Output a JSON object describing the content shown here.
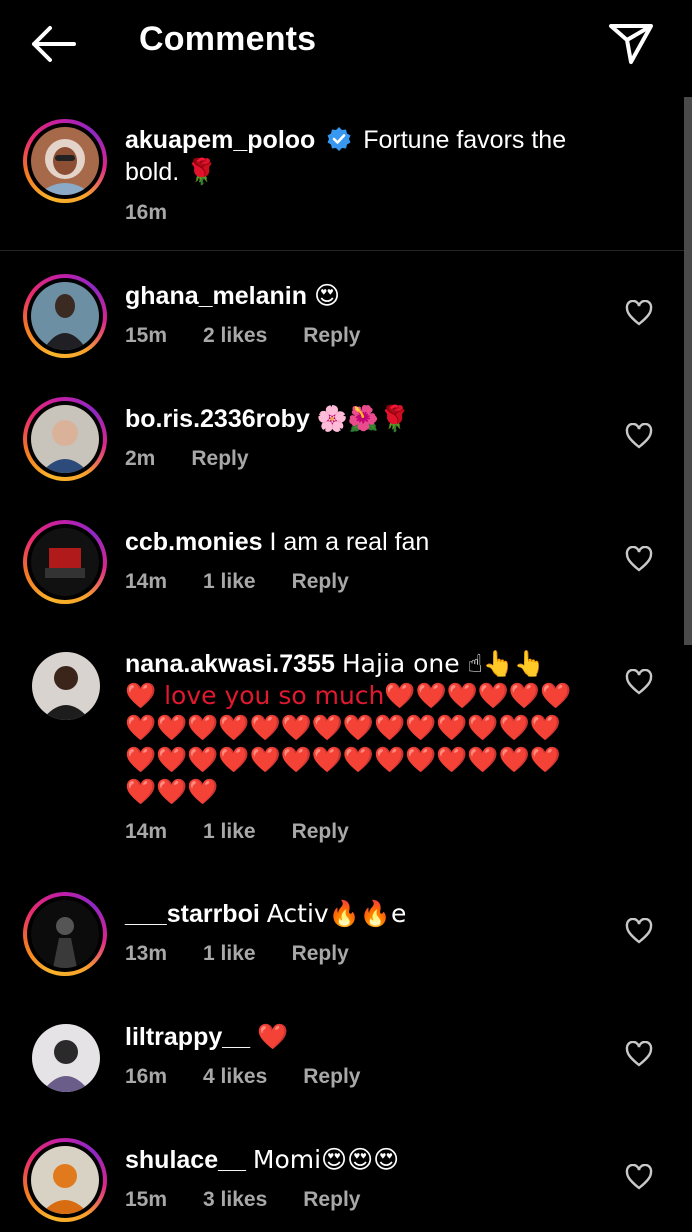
{
  "header": {
    "title": "Comments",
    "back_icon": "arrow-left-icon",
    "share_icon": "paper-plane-icon"
  },
  "caption": {
    "username": "akuapem_poloo",
    "verified": true,
    "text": "Fortune favors the bold.",
    "emoji": "🌹",
    "time": "16m"
  },
  "comments": [
    {
      "username": "ghana_melanin",
      "text": "",
      "emoji": "😍",
      "time": "15m",
      "likes": "2 likes",
      "reply": "Reply",
      "story_ring": true
    },
    {
      "username": "bo.ris.2336roby",
      "text": "",
      "emoji": "🌸🌺🌹",
      "time": "2m",
      "likes": "",
      "reply": "Reply",
      "story_ring": true
    },
    {
      "username": "ccb.monies",
      "text": "I am a real fan",
      "emoji": "",
      "time": "14m",
      "likes": "1 like",
      "reply": "Reply",
      "story_ring": true
    },
    {
      "username": "nana.akwasi.7355",
      "text": "Hajia one ☝👆👆",
      "line2": "❤️ love you so much❤️❤️❤️❤️❤️❤️",
      "line3": "❤️❤️❤️❤️❤️❤️❤️❤️❤️❤️❤️❤️❤️❤️",
      "line4": "❤️❤️❤️❤️❤️❤️❤️❤️❤️❤️❤️❤️❤️❤️",
      "line5": "❤️❤️❤️",
      "time": "14m",
      "likes": "1 like",
      "reply": "Reply",
      "story_ring": false
    },
    {
      "username": "___starrboi",
      "text": "Activ🔥🔥e",
      "emoji": "",
      "time": "13m",
      "likes": "1 like",
      "reply": "Reply",
      "story_ring": true
    },
    {
      "username": "liltrappy__",
      "text": "",
      "emoji": "❤️",
      "time": "16m",
      "likes": "4 likes",
      "reply": "Reply",
      "story_ring": false
    },
    {
      "username": "shulace__",
      "text": "Momi😍😍😍",
      "emoji": "",
      "time": "15m",
      "likes": "3 likes",
      "reply": "Reply",
      "story_ring": true
    }
  ],
  "colors": {
    "background": "#000000",
    "meta_text": "#a8a8a8",
    "verified_badge": "#3897f0",
    "heart_emoji": "#e0192f"
  }
}
